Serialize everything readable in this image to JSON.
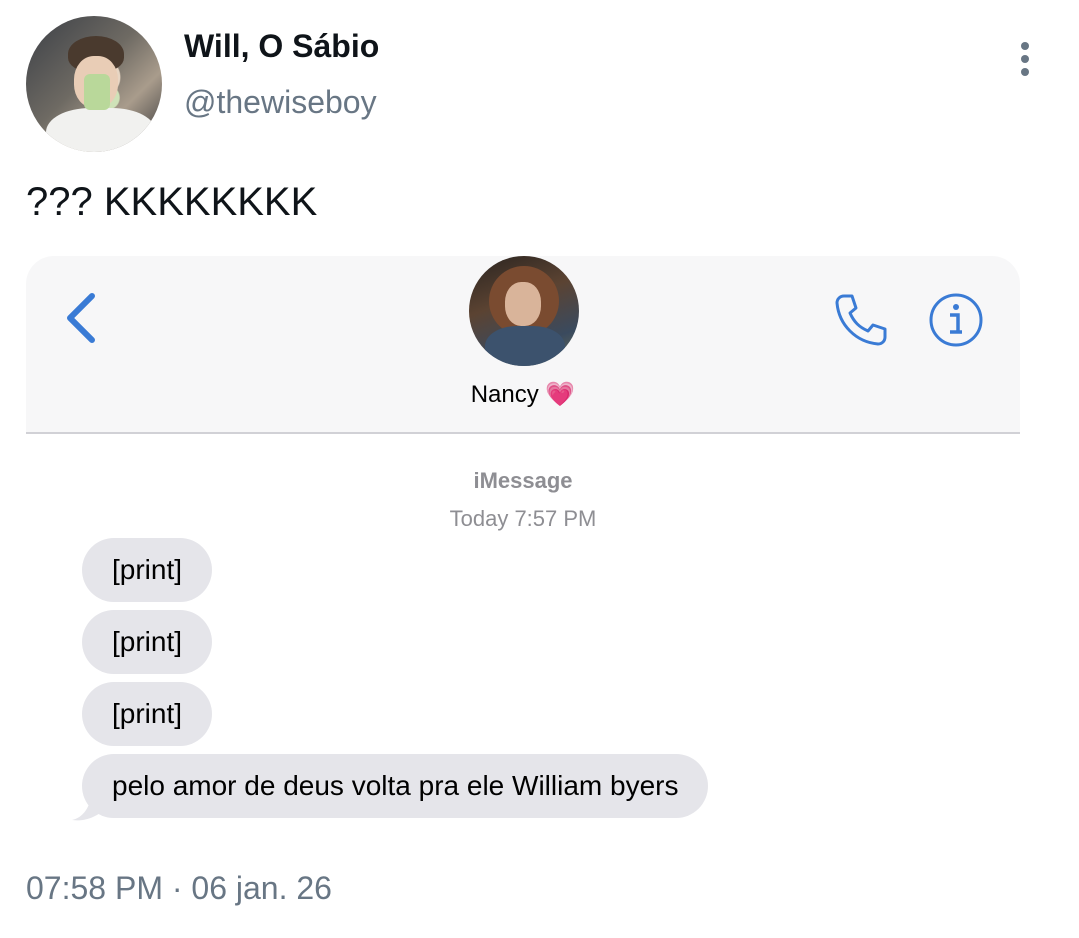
{
  "tweet": {
    "display_name": "Will, O Sábio",
    "handle": "@thewiseboy",
    "text": "??? KKKKKKKK",
    "posted_at": "07:58 PM · 06 jan. 26"
  },
  "message_screenshot": {
    "contact_name": "Nancy",
    "contact_emoji": "💗",
    "service": "iMessage",
    "timestamp": "Today 7:57 PM",
    "messages": [
      {
        "text": "[print]"
      },
      {
        "text": "[print]"
      },
      {
        "text": "[print]"
      },
      {
        "text": "pelo amor de deus volta pra ele William byers"
      }
    ],
    "accent_color": "#3a7bd5",
    "bubble_color": "#e5e5ea"
  },
  "icons": [
    "more-vertical-icon",
    "back-chevron-icon",
    "phone-icon",
    "info-icon"
  ]
}
